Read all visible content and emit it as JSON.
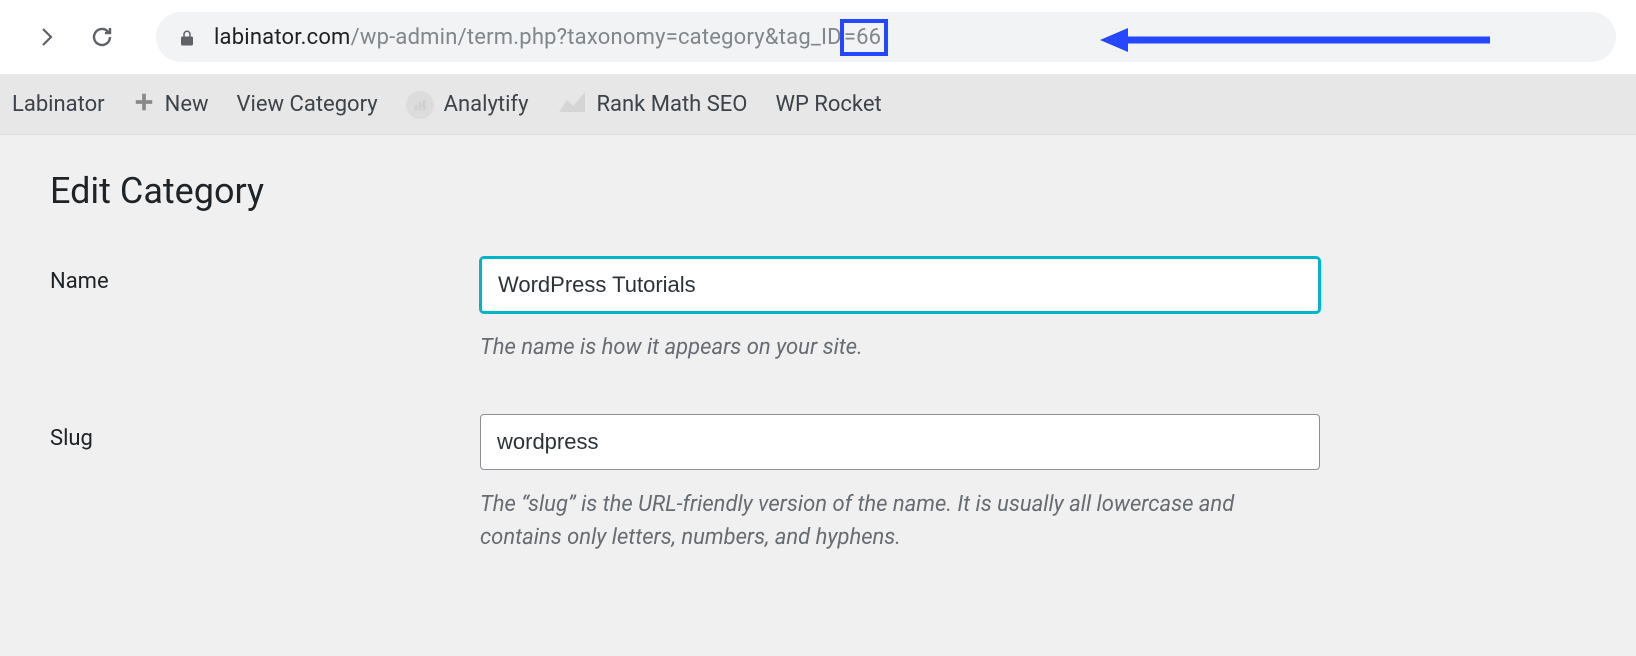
{
  "browser": {
    "url_domain": "labinator.com",
    "url_path": "/wp-admin/term.php?taxonomy=category&tag_ID",
    "url_highlight": "=66"
  },
  "adminbar": {
    "site": "Labinator",
    "new": "New",
    "view": "View Category",
    "analytify": "Analytify",
    "rankmath": "Rank Math SEO",
    "wprocket": "WP Rocket"
  },
  "page": {
    "title": "Edit Category",
    "name_label": "Name",
    "name_value": "WordPress Tutorials",
    "name_help": "The name is how it appears on your site.",
    "slug_label": "Slug",
    "slug_value": "wordpress",
    "slug_help": "The “slug” is the URL-friendly version of the name. It is usually all lowercase and contains only letters, numbers, and hyphens."
  },
  "annotation": {
    "highlight_color": "#2447ff"
  }
}
